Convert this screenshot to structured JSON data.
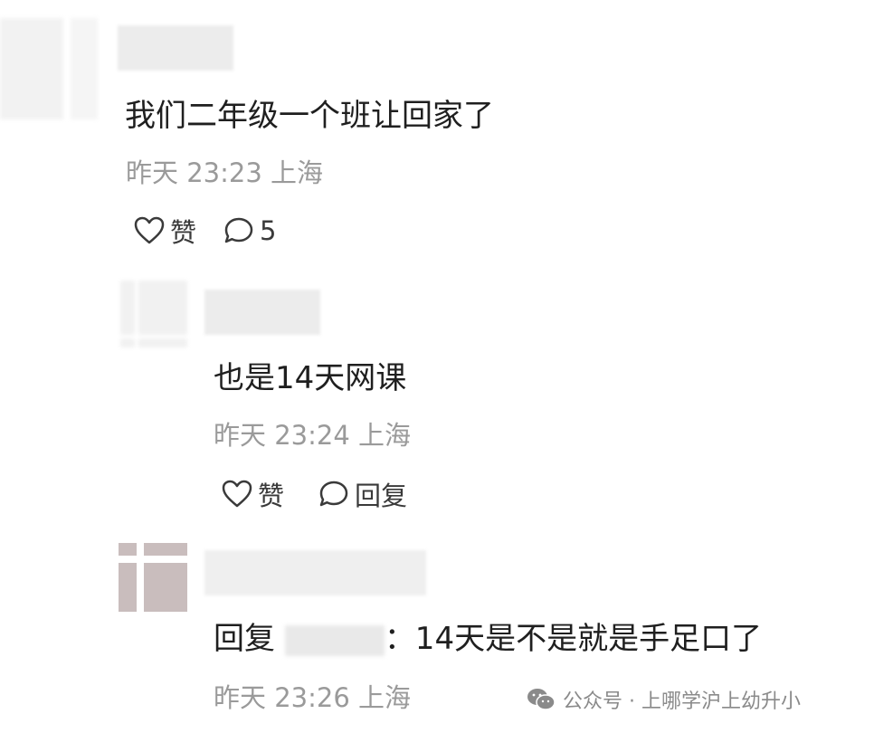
{
  "comments": [
    {
      "text": "我们二年级一个班让回家了",
      "meta": "昨天 23:23 上海",
      "like_label": "赞",
      "reply_label": "5"
    },
    {
      "text": "也是14天网课",
      "meta": "昨天 23:24 上海",
      "like_label": "赞",
      "reply_label": "回复"
    },
    {
      "text_prefix": "回复 ",
      "text_suffix": "：14天是不是就是手足口了",
      "meta": "昨天 23:26 上海"
    }
  ],
  "watermark": {
    "text": "公众号 · 上哪学沪上幼升小"
  },
  "colors": {
    "text": "#1f1f1f",
    "meta": "#9a9a9a",
    "icon": "#3a3a3a",
    "avatar_brown": "#c9bdbd"
  },
  "icons": {
    "like": "heart-outline-icon",
    "comment": "speech-bubble-icon",
    "watermark": "wechat-icon"
  }
}
